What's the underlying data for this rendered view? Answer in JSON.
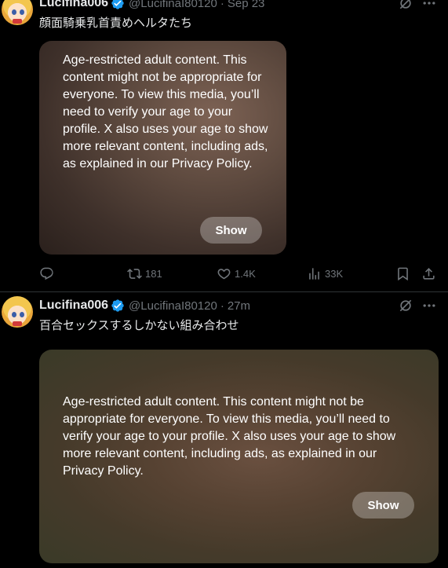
{
  "tweets": [
    {
      "author": {
        "name": "Lucifina006",
        "handle": "@LucifinaI80120",
        "time": "Sep 23"
      },
      "text": "顔面騎乗乳首責めヘルタたち",
      "media_warning": "Age-restricted adult content. This content might not be appropriate for everyone. To view this media, you’ll need to verify your age to your profile. X also uses your age to show more relevant content, including ads, as explained in our Privacy Policy.",
      "show_label": "Show",
      "stats": {
        "reposts": "181",
        "likes": "1.4K",
        "views": "33K"
      }
    },
    {
      "author": {
        "name": "Lucifina006",
        "handle": "@LucifinaI80120",
        "time": "27m"
      },
      "text": "百合セックスするしかない組み合わせ",
      "media_warning": "Age-restricted adult content. This content might not be appropriate for everyone. To view this media, you’ll need to verify your age to your profile. X also uses your age to show more relevant content, including ads, as explained in our Privacy Policy.",
      "show_label": "Show"
    }
  ],
  "dot_separator": "·",
  "colors": {
    "background": "#000000",
    "verified": "#1d9bf0",
    "muted": "#71767b",
    "text": "#e7e9ea"
  },
  "icons": [
    "verified-badge-icon",
    "grok-icon",
    "more-icon",
    "reply-icon",
    "repost-icon",
    "like-icon",
    "views-icon",
    "bookmark-icon",
    "share-icon"
  ]
}
